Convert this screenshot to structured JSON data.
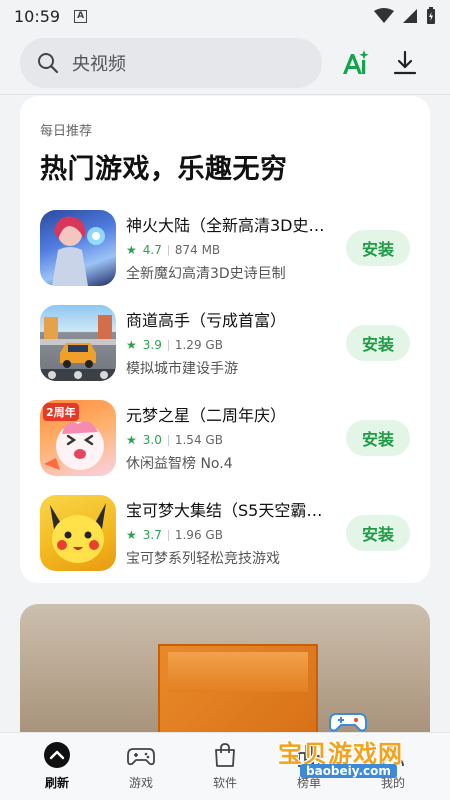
{
  "status_bar": {
    "time": "10:59",
    "notification_badge": "A"
  },
  "search": {
    "placeholder": "央视频"
  },
  "card": {
    "eyebrow": "每日推荐",
    "title": "热门游戏，乐趣无穷",
    "apps": [
      {
        "name": "神火大陆（全新高清3D史诗巨制）",
        "rating": "4.7",
        "size": "874 MB",
        "desc": "全新魔幻高清3D史诗巨制",
        "install": "安装",
        "icon": "fantasy-warrior-icon"
      },
      {
        "name": "商道高手（亏成首富）",
        "rating": "3.9",
        "size": "1.29 GB",
        "desc": "模拟城市建设手游",
        "install": "安装",
        "icon": "city-car-icon"
      },
      {
        "name": "元梦之星（二周年庆）",
        "rating": "3.0",
        "size": "1.54 GB",
        "desc": "休闲益智榜 No.4",
        "install": "安装",
        "icon": "anniversary-character-icon",
        "icon_badge": "2周年"
      },
      {
        "name": "宝可梦大集结（S5天空霸主）",
        "rating": "3.7",
        "size": "1.96 GB",
        "desc": "宝可梦系列轻松竞技游戏",
        "install": "安装",
        "icon": "pikachu-icon"
      }
    ]
  },
  "banner": {
    "label": "orange-gift-box-photo"
  },
  "bottom_nav": {
    "items": [
      {
        "label": "刷新",
        "icon": "refresh-up-icon",
        "active": true
      },
      {
        "label": "游戏",
        "icon": "gamepad-icon",
        "active": false
      },
      {
        "label": "软件",
        "icon": "shopping-bag-icon",
        "active": false
      },
      {
        "label": "榜单",
        "icon": "ranking-icon",
        "active": false
      },
      {
        "label": "我的",
        "icon": "profile-icon",
        "active": false
      }
    ]
  },
  "watermark": {
    "text": "宝贝游戏网",
    "url": "baobeiy.com"
  },
  "colors": {
    "accent_green": "#1f9a45",
    "install_bg": "#e3f5e7",
    "page_bg": "#f2f3f5"
  }
}
